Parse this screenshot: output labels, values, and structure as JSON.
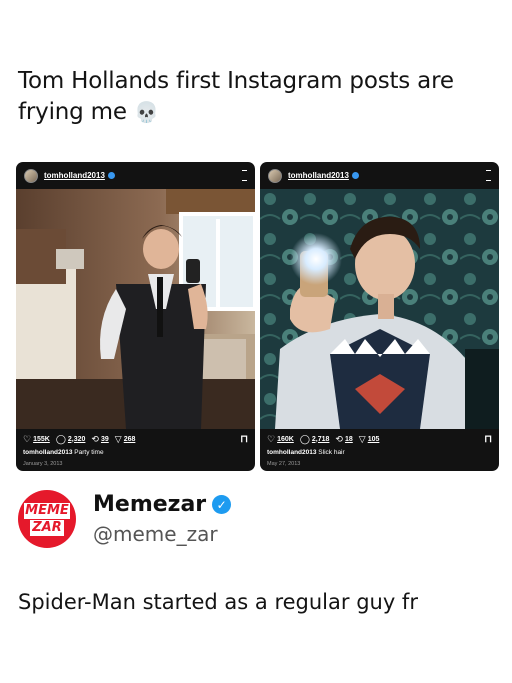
{
  "headline": "Tom Hollands first Instagram posts are frying me",
  "headline_emoji": "💀",
  "posts": [
    {
      "username": "tomholland2013",
      "likes": "155K",
      "comments": "2,320",
      "reposts": "39",
      "shares": "268",
      "caption_user": "tomholland2013",
      "caption_text": "Party time",
      "date": "January 3, 2013"
    },
    {
      "username": "tomholland2013",
      "likes": "160K",
      "comments": "2,718",
      "reposts": "18",
      "shares": "105",
      "caption_user": "tomholland2013",
      "caption_text": "Slick hair",
      "date": "May 27, 2013"
    }
  ],
  "author": {
    "name": "Memezar",
    "handle": "@meme_zar",
    "logo_line1": "MEME",
    "logo_line2": "ZAR"
  },
  "tweet_text": "Spider-Man started as a regular guy fr",
  "colors": {
    "brand_red": "#e5192b",
    "verified_blue": "#1d9bf0",
    "post_bg": "#121212"
  },
  "icons": [
    "skull-emoji",
    "heart-icon",
    "comment-icon",
    "repost-icon",
    "share-icon",
    "bookmark-icon",
    "menu-icon",
    "verified-icon"
  ]
}
